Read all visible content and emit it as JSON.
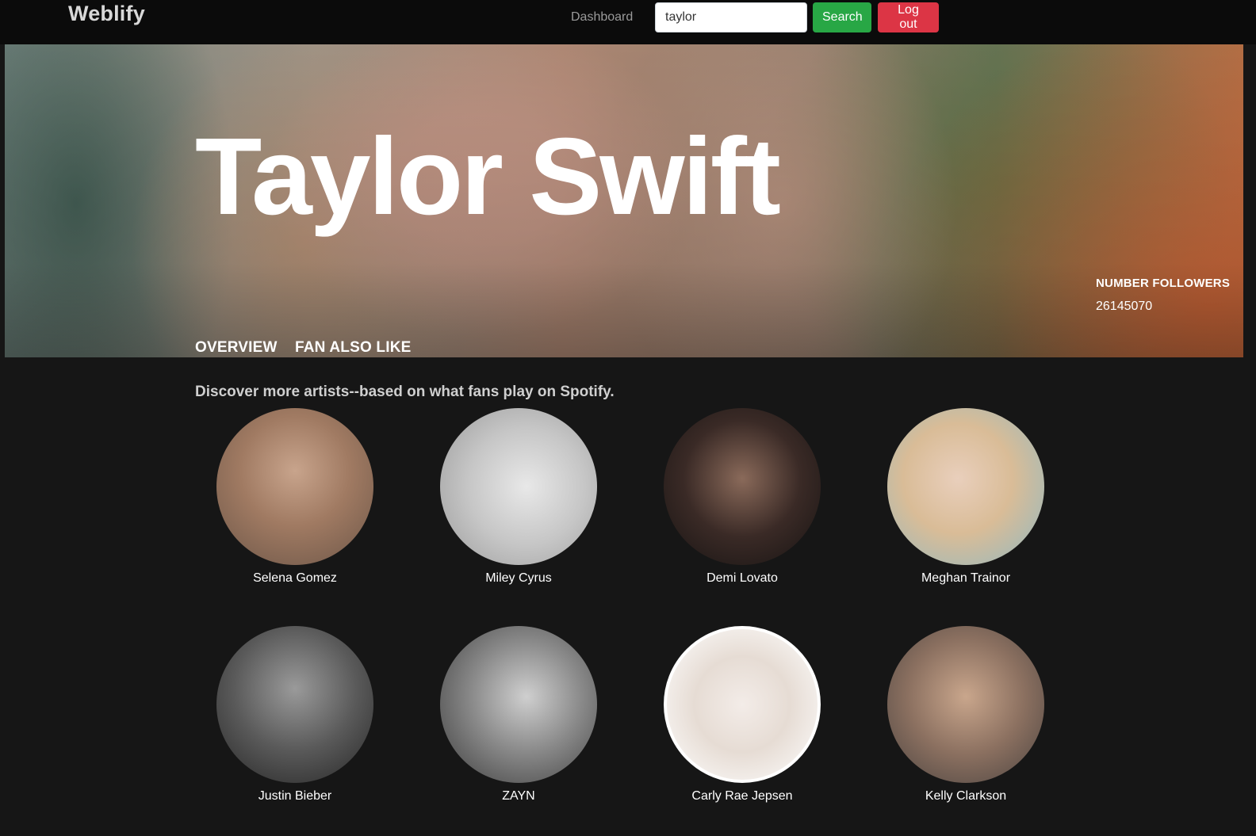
{
  "navbar": {
    "brand": "Weblify",
    "dashboard_link": "Dashboard",
    "search_value": "taylor",
    "search_button": "Search",
    "logout_button": "Log out"
  },
  "hero": {
    "artist_name": "Taylor Swift",
    "followers_label": "NUMBER FOLLOWERS",
    "followers_value": "26145070",
    "tabs": [
      "OVERVIEW",
      "FAN ALSO LIKE"
    ]
  },
  "related": {
    "heading": "Discover more artists--based on what fans play on Spotify.",
    "artists": [
      {
        "name": "Selena Gomez"
      },
      {
        "name": "Miley Cyrus"
      },
      {
        "name": "Demi Lovato"
      },
      {
        "name": "Meghan Trainor"
      },
      {
        "name": "Justin Bieber"
      },
      {
        "name": "ZAYN"
      },
      {
        "name": "Carly Rae Jepsen"
      },
      {
        "name": "Kelly Clarkson"
      }
    ]
  },
  "colors": {
    "background": "#161616",
    "navbar": "#0b0b0b",
    "search_button": "#28a745",
    "logout_button": "#dc3545"
  }
}
